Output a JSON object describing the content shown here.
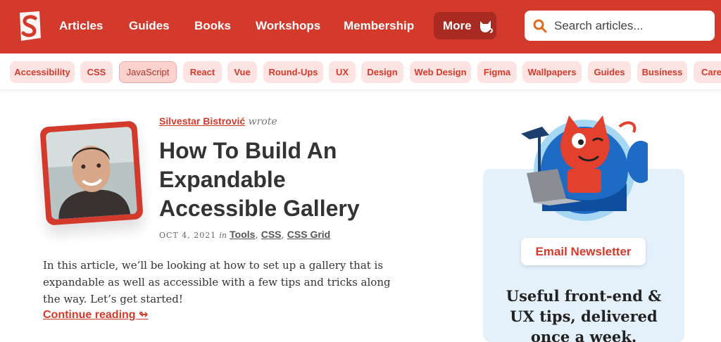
{
  "header": {
    "nav": [
      "Articles",
      "Guides",
      "Books",
      "Workshops",
      "Membership"
    ],
    "more_label": "More",
    "search_placeholder": "Search articles..."
  },
  "tags": [
    "Accessibility",
    "CSS",
    "JavaScript",
    "React",
    "Vue",
    "Round-Ups",
    "UX",
    "Design",
    "Web Design",
    "Figma",
    "Wallpapers",
    "Guides",
    "Business",
    "Caree"
  ],
  "article": {
    "author": "Silvestar Bistrović",
    "wrote": "wrote",
    "title": "How To Build An Expandable Accessible Gallery",
    "date": "OCT 4, 2021",
    "in": "in",
    "categories": [
      "Tools",
      "CSS",
      "CSS Grid"
    ],
    "excerpt": "In this article, we’ll be looking at how to set up a gallery that is expandable as well as accessible with a few tips and tricks along the way. Let’s get started!",
    "continue": "Continue reading ↬"
  },
  "sidebar": {
    "button": "Email Newsletter",
    "text": "Useful front-end & UX tips, delivered once a week."
  },
  "colors": {
    "brand": "#d33a2c",
    "tag_bg": "#fde3e1",
    "panel_bg": "#e4f1fb"
  }
}
